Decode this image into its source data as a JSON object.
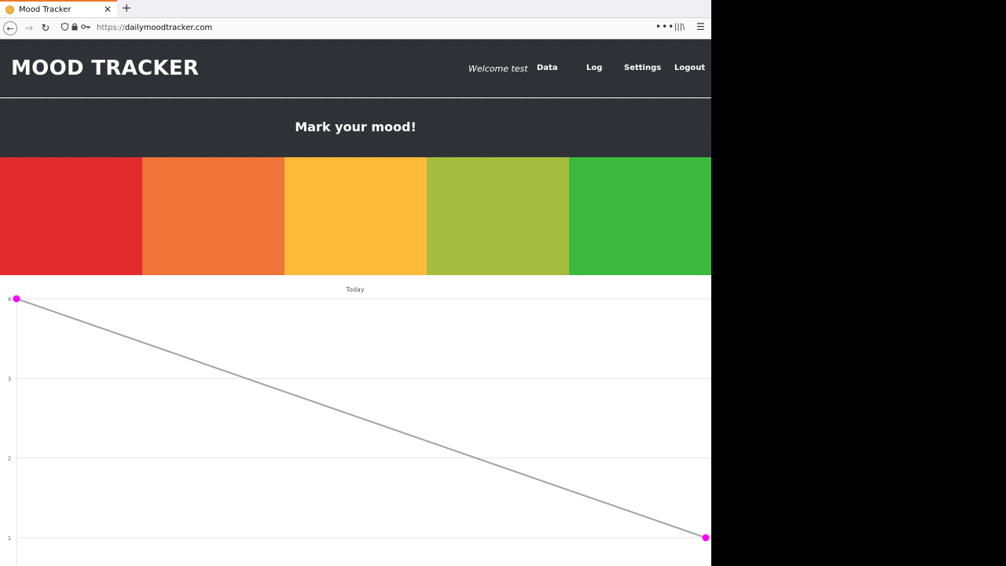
{
  "browser": {
    "tab_title": "Mood Tracker",
    "tab_close": "✕",
    "new_tab": "+",
    "url_protocol": "https://",
    "url_host": "dailymoodtracker.com",
    "page_actions": "•••",
    "library": "|||\\",
    "menu": "☰"
  },
  "site": {
    "logo": "MOOD TRACKER",
    "welcome": "Welcome test",
    "nav": {
      "data": "Data",
      "log": "Log",
      "settings": "Settings",
      "logout": "Logout"
    },
    "mood_title": "Mark your mood!",
    "mood_colors": [
      "#e32b2e",
      "#f07338",
      "#fcbb3a",
      "#a4bd3e",
      "#3dba3e"
    ]
  },
  "chart_data": {
    "type": "line",
    "title": "Today",
    "x": [
      0,
      1
    ],
    "values": [
      4,
      1
    ],
    "yticks": [
      1,
      2,
      3,
      4
    ],
    "ylim": [
      1,
      4
    ],
    "line_color": "#9fa2a8",
    "point_color": "#ff00ff",
    "grid": true
  }
}
